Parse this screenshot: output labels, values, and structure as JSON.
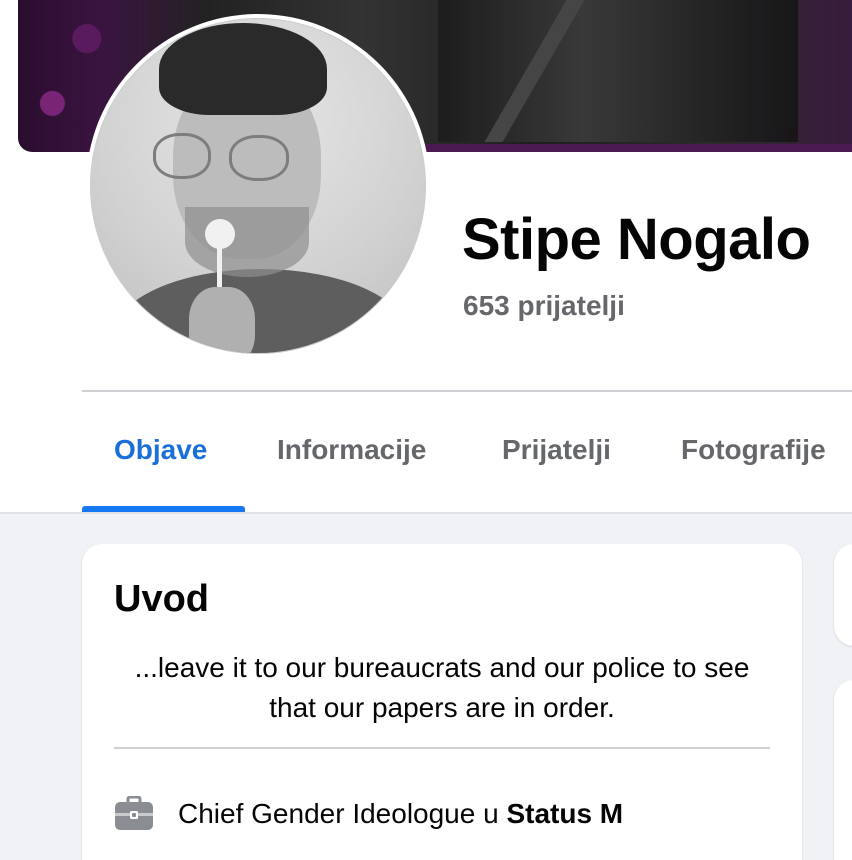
{
  "profile": {
    "name": "Stipe Nogalo",
    "friends_count": "653 prijatelji"
  },
  "tabs": [
    {
      "label": "Objave",
      "active": true
    },
    {
      "label": "Informacije",
      "active": false
    },
    {
      "label": "Prijatelji",
      "active": false
    },
    {
      "label": "Fotografije",
      "active": false
    }
  ],
  "intro": {
    "title": "Uvod",
    "bio": "...leave it to our bureaucrats and our police to see that our papers are in order.",
    "work": {
      "icon": "briefcase-icon",
      "role_text": "Chief Gender Ideologue u ",
      "company": "Status M"
    }
  },
  "colors": {
    "accent": "#1877f2",
    "active_tab_text": "#1b6fd8",
    "secondary_text": "#65676b",
    "feed_background": "#f0f2f5"
  }
}
